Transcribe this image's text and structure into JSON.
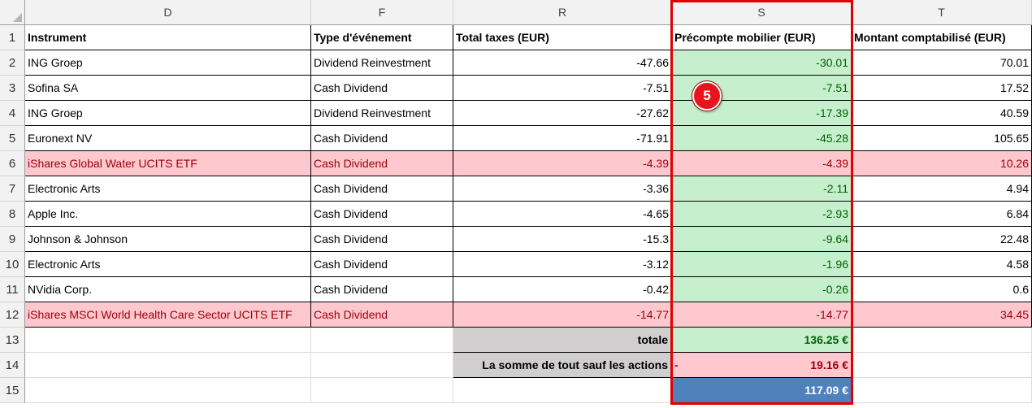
{
  "columns": [
    {
      "id": "D",
      "letter": "D"
    },
    {
      "id": "F",
      "letter": "F"
    },
    {
      "id": "R",
      "letter": "R"
    },
    {
      "id": "S",
      "letter": "S"
    },
    {
      "id": "T",
      "letter": "T"
    }
  ],
  "row_numbers": [
    "1",
    "2",
    "3",
    "4",
    "5",
    "6",
    "7",
    "8",
    "9",
    "10",
    "11",
    "12",
    "13",
    "14",
    "15"
  ],
  "headers": {
    "instrument": "Instrument",
    "event_type": "Type d'événement",
    "total_taxes": "Total taxes (EUR)",
    "withholding": "Précompte mobilier (EUR)",
    "amount": "Montant comptabilisé (EUR)"
  },
  "rows": [
    {
      "instrument": "ING Groep",
      "event": "Dividend Reinvestment",
      "total_taxes": "-47.66",
      "withholding": "-30.01",
      "amount": "70.01",
      "highlight": false
    },
    {
      "instrument": "Sofina SA",
      "event": "Cash Dividend",
      "total_taxes": "-7.51",
      "withholding": "-7.51",
      "amount": "17.52",
      "highlight": false
    },
    {
      "instrument": "ING Groep",
      "event": "Dividend Reinvestment",
      "total_taxes": "-27.62",
      "withholding": "-17.39",
      "amount": "40.59",
      "highlight": false
    },
    {
      "instrument": "Euronext NV",
      "event": "Cash Dividend",
      "total_taxes": "-71.91",
      "withholding": "-45.28",
      "amount": "105.65",
      "highlight": false
    },
    {
      "instrument": "iShares Global Water UCITS ETF",
      "event": "Cash Dividend",
      "total_taxes": "-4.39",
      "withholding": "-4.39",
      "amount": "10.26",
      "highlight": true
    },
    {
      "instrument": "Electronic Arts",
      "event": "Cash Dividend",
      "total_taxes": "-3.36",
      "withholding": "-2.11",
      "amount": "4.94",
      "highlight": false
    },
    {
      "instrument": "Apple Inc.",
      "event": "Cash Dividend",
      "total_taxes": "-4.65",
      "withholding": "-2.93",
      "amount": "6.84",
      "highlight": false
    },
    {
      "instrument": "Johnson & Johnson",
      "event": "Cash Dividend",
      "total_taxes": "-15.3",
      "withholding": "-9.64",
      "amount": "22.48",
      "highlight": false
    },
    {
      "instrument": "Electronic Arts",
      "event": "Cash Dividend",
      "total_taxes": "-3.12",
      "withholding": "-1.96",
      "amount": "4.58",
      "highlight": false
    },
    {
      "instrument": "NVidia Corp.",
      "event": "Cash Dividend",
      "total_taxes": "-0.42",
      "withholding": "-0.26",
      "amount": "0.6",
      "highlight": false
    },
    {
      "instrument": "iShares MSCI World Health Care Sector UCITS ETF",
      "event": "Cash Dividend",
      "total_taxes": "-14.77",
      "withholding": "-14.77",
      "amount": "34.45",
      "highlight": true
    }
  ],
  "summary": {
    "total_label": "totale",
    "total_value": "136.25 €",
    "except_label": "La somme de tout sauf les actions",
    "except_sign": "-",
    "except_value": "19.16 €",
    "result_value": "117.09 €"
  },
  "annotation": {
    "marker": "5"
  },
  "colors": {
    "highlight_border": "#e10000",
    "pink_fill": "#ffc7ce",
    "pink_text": "#9c0006",
    "green_fill": "#c6efce",
    "green_text": "#006100",
    "blue_fill": "#4f81bd",
    "gray_fill": "#d0cece"
  }
}
